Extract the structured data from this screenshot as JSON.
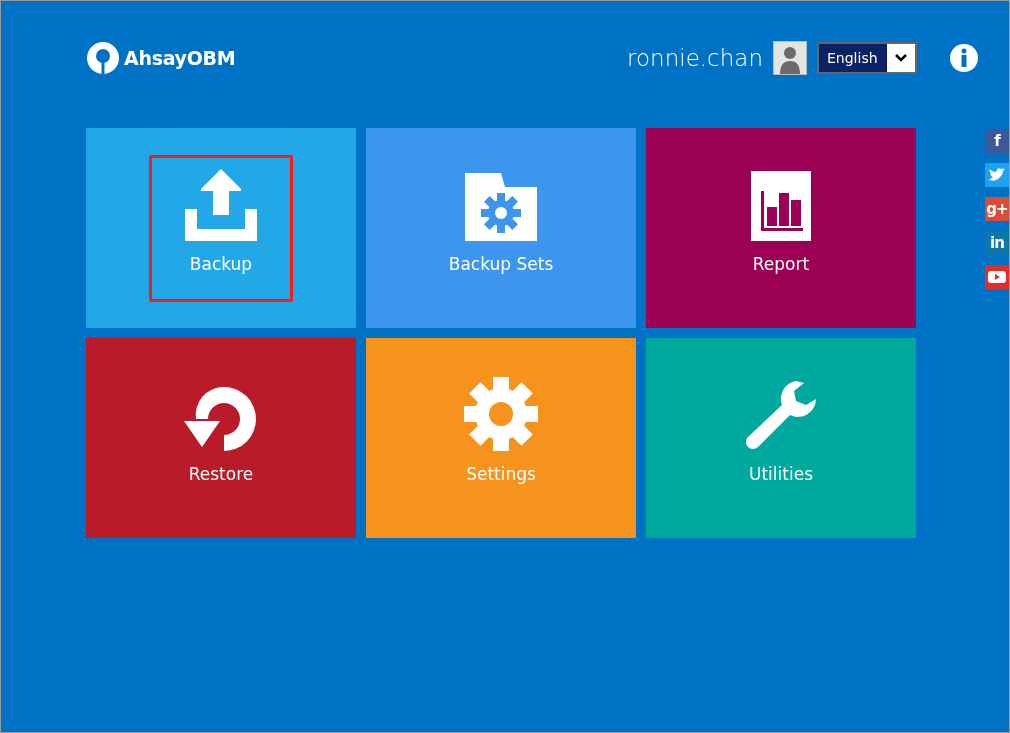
{
  "header": {
    "logo": "AhsayOBM",
    "username": "ronnie.chan",
    "language": {
      "value": "English"
    }
  },
  "tiles": [
    {
      "kind": "backup",
      "label": "Backup",
      "color": "#22a8e6",
      "highlighted": true
    },
    {
      "kind": "backup-sets",
      "label": "Backup Sets",
      "color": "#3c96ee",
      "highlighted": false
    },
    {
      "kind": "report",
      "label": "Report",
      "color": "#9b0055",
      "highlighted": false
    },
    {
      "kind": "restore",
      "label": "Restore",
      "color": "#ba1b2a",
      "highlighted": false
    },
    {
      "kind": "settings",
      "label": "Settings",
      "color": "#f6931d",
      "highlighted": false
    },
    {
      "kind": "utilities",
      "label": "Utilities",
      "color": "#00a99d",
      "highlighted": false
    }
  ],
  "social": [
    {
      "kind": "facebook",
      "text": "f"
    },
    {
      "kind": "twitter"
    },
    {
      "kind": "google",
      "text": "g+"
    },
    {
      "kind": "linkedin",
      "text": "in"
    },
    {
      "kind": "youtube"
    }
  ]
}
